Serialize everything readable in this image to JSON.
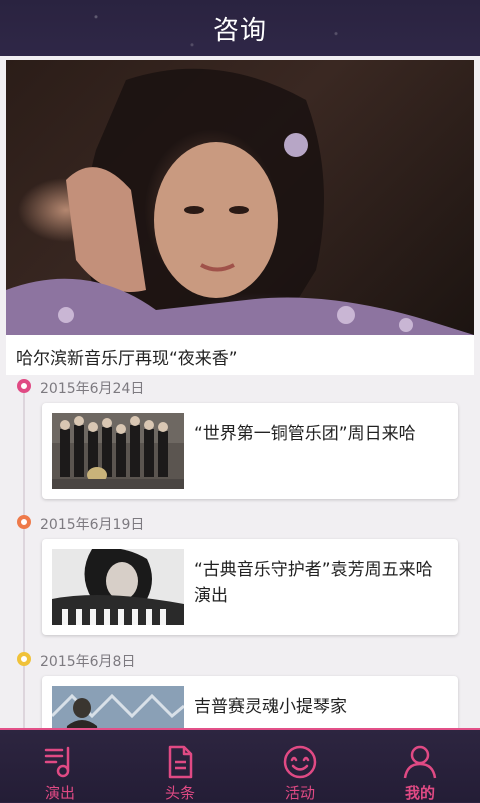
{
  "header": {
    "title": "咨询"
  },
  "hero": {
    "caption": "哈尔滨新音乐厅再现“夜来香”"
  },
  "timeline": [
    {
      "date": "2015年6月24日",
      "title": "“世界第一铜管乐团”周日来哈",
      "dot_color": "#e04a84"
    },
    {
      "date": "2015年6月19日",
      "title": "“古典音乐守护者”袁芳周五来哈演出",
      "dot_color": "#ee7a4a"
    },
    {
      "date": "2015年6月8日",
      "title": "吉普赛灵魂小提琴家",
      "dot_color": "#f0c23a"
    }
  ],
  "tabs": [
    {
      "label": "演出",
      "icon": "music-note-icon"
    },
    {
      "label": "头条",
      "icon": "document-icon"
    },
    {
      "label": "活动",
      "icon": "smiley-icon"
    },
    {
      "label": "我的",
      "icon": "person-icon"
    }
  ],
  "colors": {
    "accent": "#e04a84",
    "header_bg": "#2b2340"
  }
}
